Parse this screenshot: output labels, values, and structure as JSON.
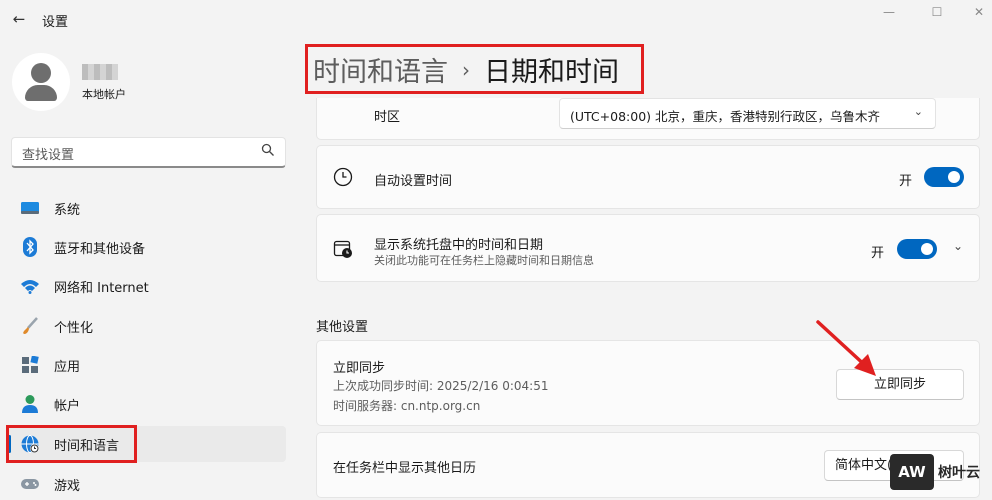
{
  "window": {
    "title": "设置",
    "back": "←",
    "minimize": "—",
    "maximize": "☐",
    "close": "✕"
  },
  "user": {
    "account_type": "本地帐户"
  },
  "search": {
    "placeholder": "查找设置",
    "icon": "search-icon"
  },
  "nav": [
    {
      "label": "系统",
      "icon": "monitor-icon"
    },
    {
      "label": "蓝牙和其他设备",
      "icon": "bluetooth-icon"
    },
    {
      "label": "网络和 Internet",
      "icon": "wifi-icon"
    },
    {
      "label": "个性化",
      "icon": "brush-icon"
    },
    {
      "label": "应用",
      "icon": "apps-icon"
    },
    {
      "label": "帐户",
      "icon": "person-icon"
    },
    {
      "label": "时间和语言",
      "icon": "globe-clock-icon",
      "active": true
    },
    {
      "label": "游戏",
      "icon": "gamepad-icon"
    }
  ],
  "breadcrumb": {
    "parent": "时间和语言",
    "separator": "›",
    "current": "日期和时间"
  },
  "timezone": {
    "label": "时区",
    "value": "(UTC+08:00) 北京，重庆，香港特别行政区，乌鲁木齐",
    "chevron": "⌄"
  },
  "auto_time": {
    "label": "自动设置时间",
    "state_label": "开",
    "on": true
  },
  "tray": {
    "label": "显示系统托盘中的时间和日期",
    "sub": "关闭此功能可在任务栏上隐藏时间和日期信息",
    "state_label": "开",
    "on": true,
    "chevron": "⌄"
  },
  "other": {
    "title": "其他设置"
  },
  "sync": {
    "title": "立即同步",
    "last_sync": "上次成功同步时间: 2025/2/16 0:04:51",
    "server": "时间服务器: cn.ntp.org.cn",
    "button": "立即同步"
  },
  "calendar": {
    "label": "在任务栏中显示其他日历",
    "value": "简体中文(农历)"
  },
  "watermark": {
    "logo": "AW",
    "text": "树叶云"
  },
  "colors": {
    "accent": "#0067c0",
    "annotation": "#e02020",
    "background": "#f3f3f3",
    "card": "#fbfbfb"
  }
}
